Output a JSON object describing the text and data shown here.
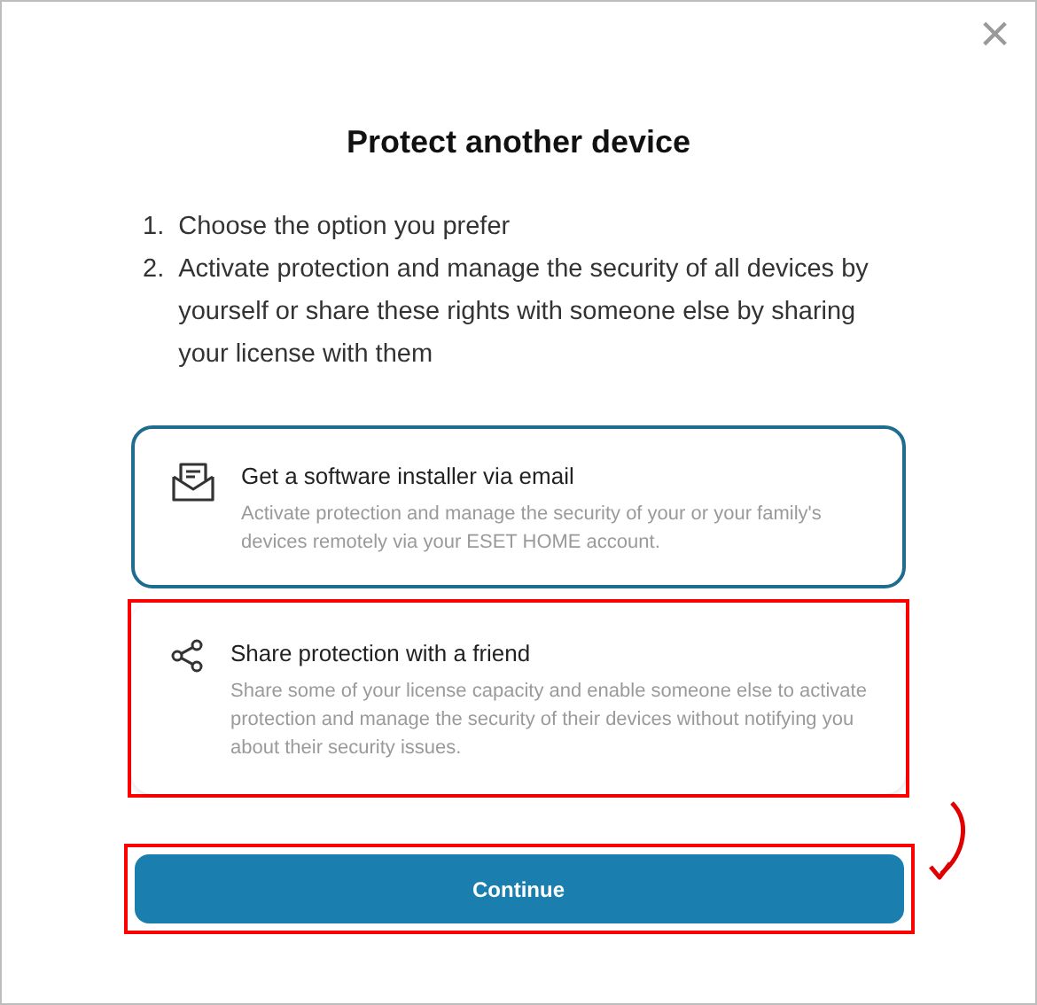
{
  "dialog": {
    "title": "Protect another device",
    "close_label": "×"
  },
  "steps": [
    {
      "number": "1.",
      "text": "Choose the option you prefer"
    },
    {
      "number": "2.",
      "text": "Activate protection and manage the security of all devices by yourself or share these rights with someone else by sharing your license with them"
    }
  ],
  "options": [
    {
      "kind": "email",
      "title": "Get a software installer via email",
      "description": "Activate protection and manage the security of your or your family's devices remotely via your ESET HOME account.",
      "selected": true,
      "highlighted": false
    },
    {
      "kind": "share",
      "title": "Share protection with a friend",
      "description": "Share some of your license capacity and enable someone else to activate protection and manage the security of their devices without notifying you about their security issues.",
      "selected": false,
      "highlighted": true
    }
  ],
  "continue_button": {
    "label": "Continue",
    "highlighted": true
  }
}
